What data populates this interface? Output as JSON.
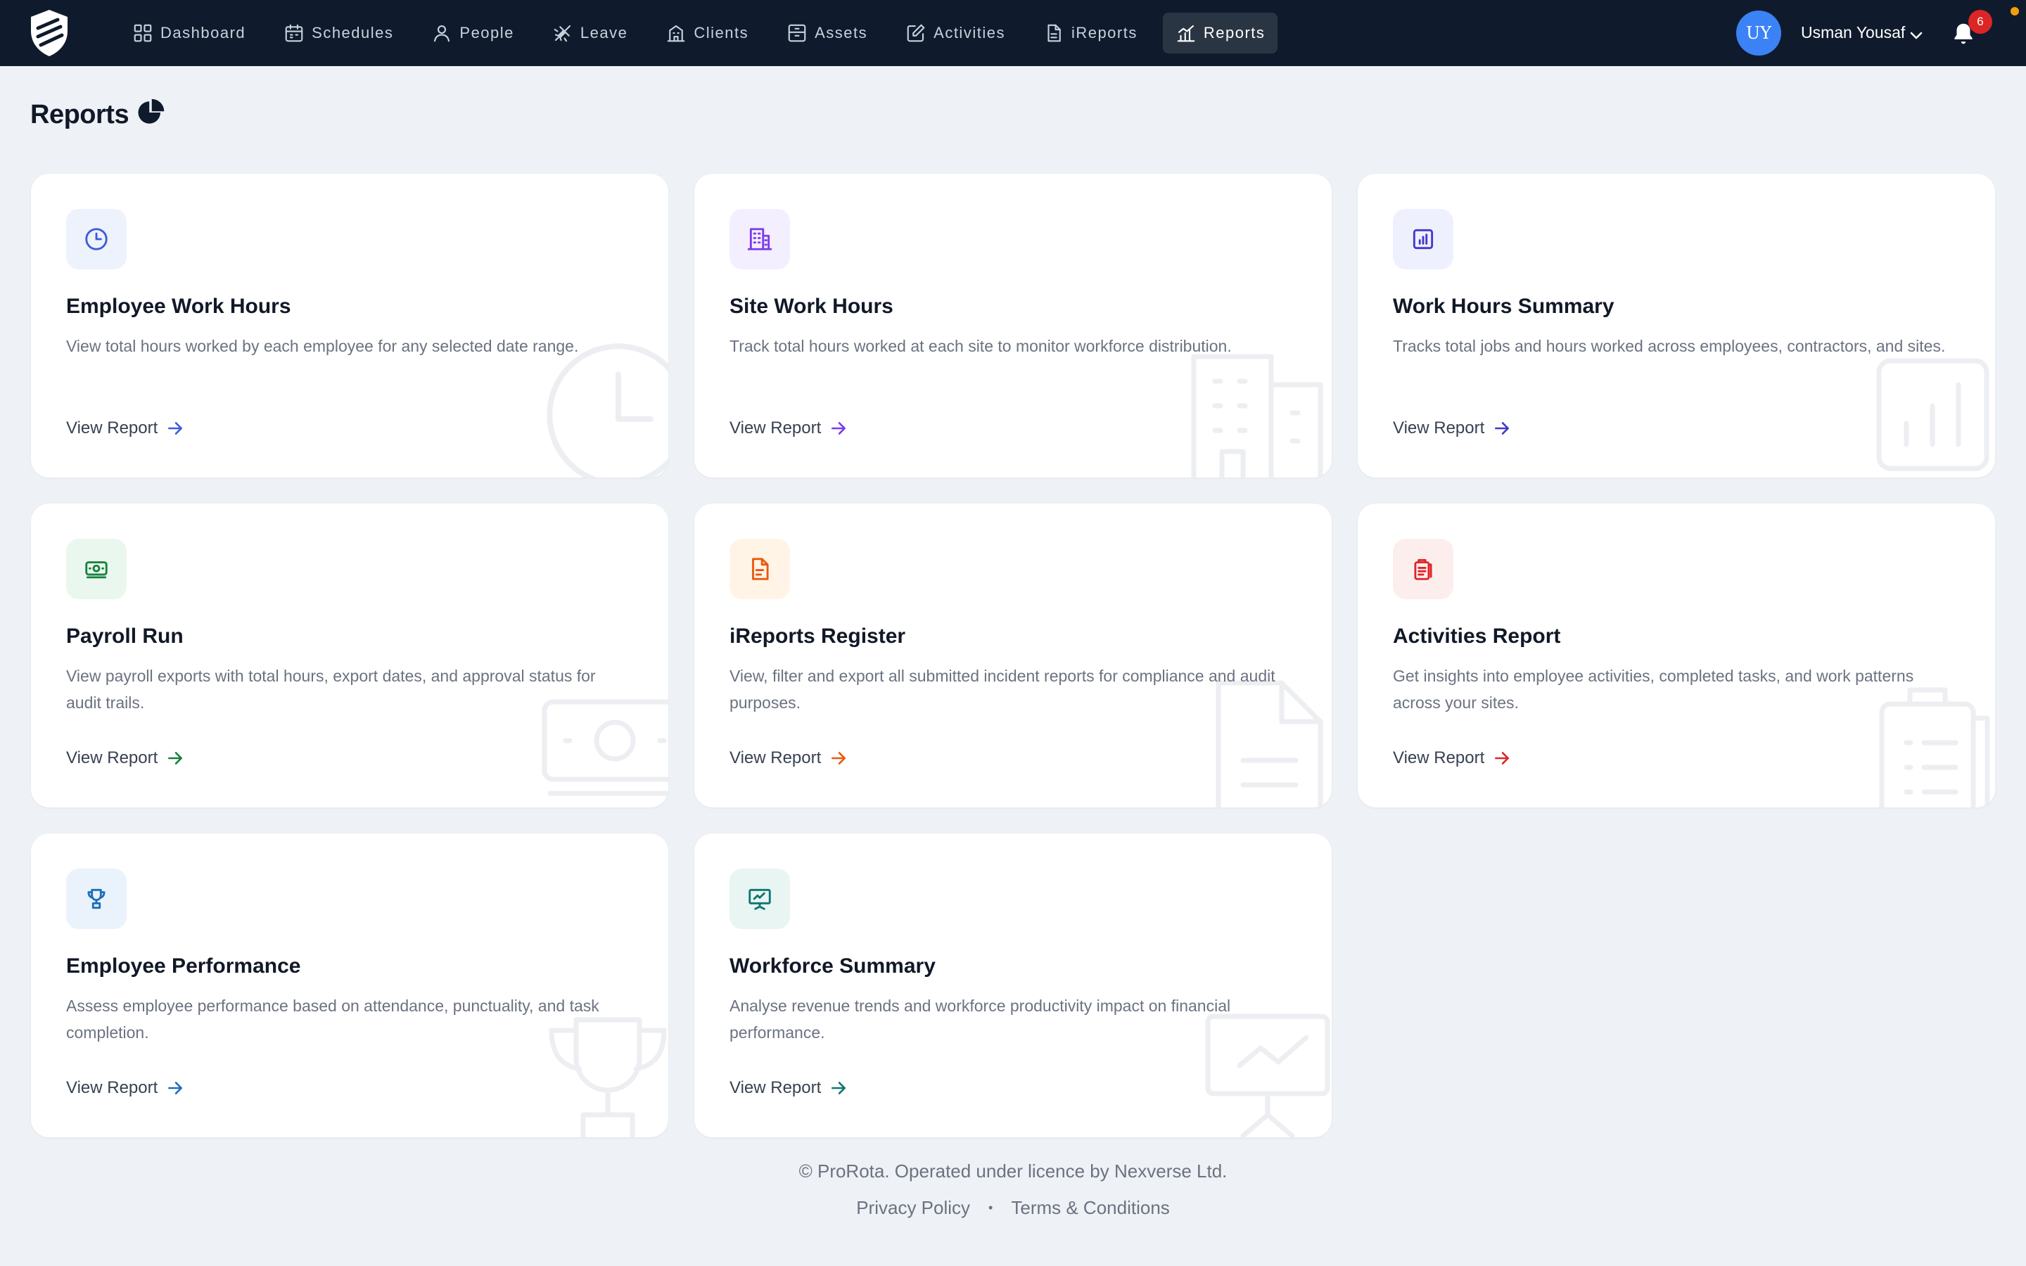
{
  "nav": {
    "items": [
      {
        "label": "Dashboard",
        "icon": "grid-icon"
      },
      {
        "label": "Schedules",
        "icon": "calendar-icon"
      },
      {
        "label": "People",
        "icon": "person-icon"
      },
      {
        "label": "Leave",
        "icon": "plane-icon"
      },
      {
        "label": "Clients",
        "icon": "building-icon"
      },
      {
        "label": "Assets",
        "icon": "box-icon"
      },
      {
        "label": "Activities",
        "icon": "edit-icon"
      },
      {
        "label": "iReports",
        "icon": "document-icon"
      },
      {
        "label": "Reports",
        "icon": "bar-chart-icon",
        "active": true
      }
    ],
    "user": {
      "initials": "UY",
      "name": "Usman Yousaf"
    },
    "notifications_count": "6"
  },
  "page": {
    "title": "Reports"
  },
  "cards": [
    {
      "title": "Employee Work Hours",
      "description": "View total hours worked by each employee for any selected date range.",
      "link": "View Report",
      "icon": "clock-icon",
      "accent": "#3b5bdb"
    },
    {
      "title": "Site Work Hours",
      "description": "Track total hours worked at each site to monitor workforce distribution.",
      "link": "View Report",
      "icon": "building-icon",
      "accent": "#7c3aed"
    },
    {
      "title": "Work Hours Summary",
      "description": "Tracks total jobs and hours worked across employees, contractors, and sites.",
      "link": "View Report",
      "icon": "bar-chart-icon",
      "accent": "#4338ca"
    },
    {
      "title": "Payroll Run",
      "description": "View payroll exports with total hours, export dates, and approval status for audit trails.",
      "link": "View Report",
      "icon": "money-icon",
      "accent": "#15803d"
    },
    {
      "title": "iReports Register",
      "description": "View, filter and export all submitted incident reports for compliance and audit purposes.",
      "link": "View Report",
      "icon": "document-icon",
      "accent": "#ea580c"
    },
    {
      "title": "Activities Report",
      "description": "Get insights into employee activities, completed tasks, and work patterns across your sites.",
      "link": "View Report",
      "icon": "clipboard-icon",
      "accent": "#dc2626"
    },
    {
      "title": "Employee Performance",
      "description": "Assess employee performance based on attendance, punctuality, and task completion.",
      "link": "View Report",
      "icon": "trophy-icon",
      "accent": "#1d6fb8"
    },
    {
      "title": "Workforce Summary",
      "description": "Analyse revenue trends and workforce productivity impact on financial performance.",
      "link": "View Report",
      "icon": "presentation-icon",
      "accent": "#0f766e"
    }
  ],
  "footer": {
    "copyright": "© ProRota. Operated under licence by Nexverse Ltd.",
    "privacy": "Privacy Policy",
    "separator": "•",
    "terms": "Terms & Conditions"
  }
}
